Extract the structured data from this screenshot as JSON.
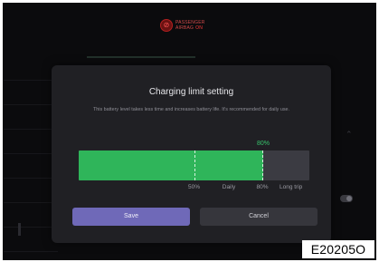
{
  "status": {
    "airbag_line1": "PASSENGER",
    "airbag_line2": "AIRBAG",
    "airbag_state": "ON",
    "icon": "airbag-off-icon"
  },
  "dialog": {
    "title": "Charging limit setting",
    "description": "This battery level takes less time and increases battery life. It's recommended for daily use.",
    "selected_percent_label": "80%",
    "charge_limit": {
      "value": 80,
      "unit": "%",
      "max": 100
    },
    "markers": [
      {
        "label": "50%",
        "value": 50
      },
      {
        "label": "Daily",
        "value": 65
      },
      {
        "label": "80%",
        "value": 80
      },
      {
        "label": "Long trip",
        "value": 92
      }
    ],
    "save_label": "Save",
    "cancel_label": "Cancel"
  },
  "figure_code": "E20205O",
  "colors": {
    "accent_green": "#2fb55a",
    "save_button": "#6f69b8",
    "cancel_button": "#36363c",
    "dialog_bg": "#202024"
  }
}
